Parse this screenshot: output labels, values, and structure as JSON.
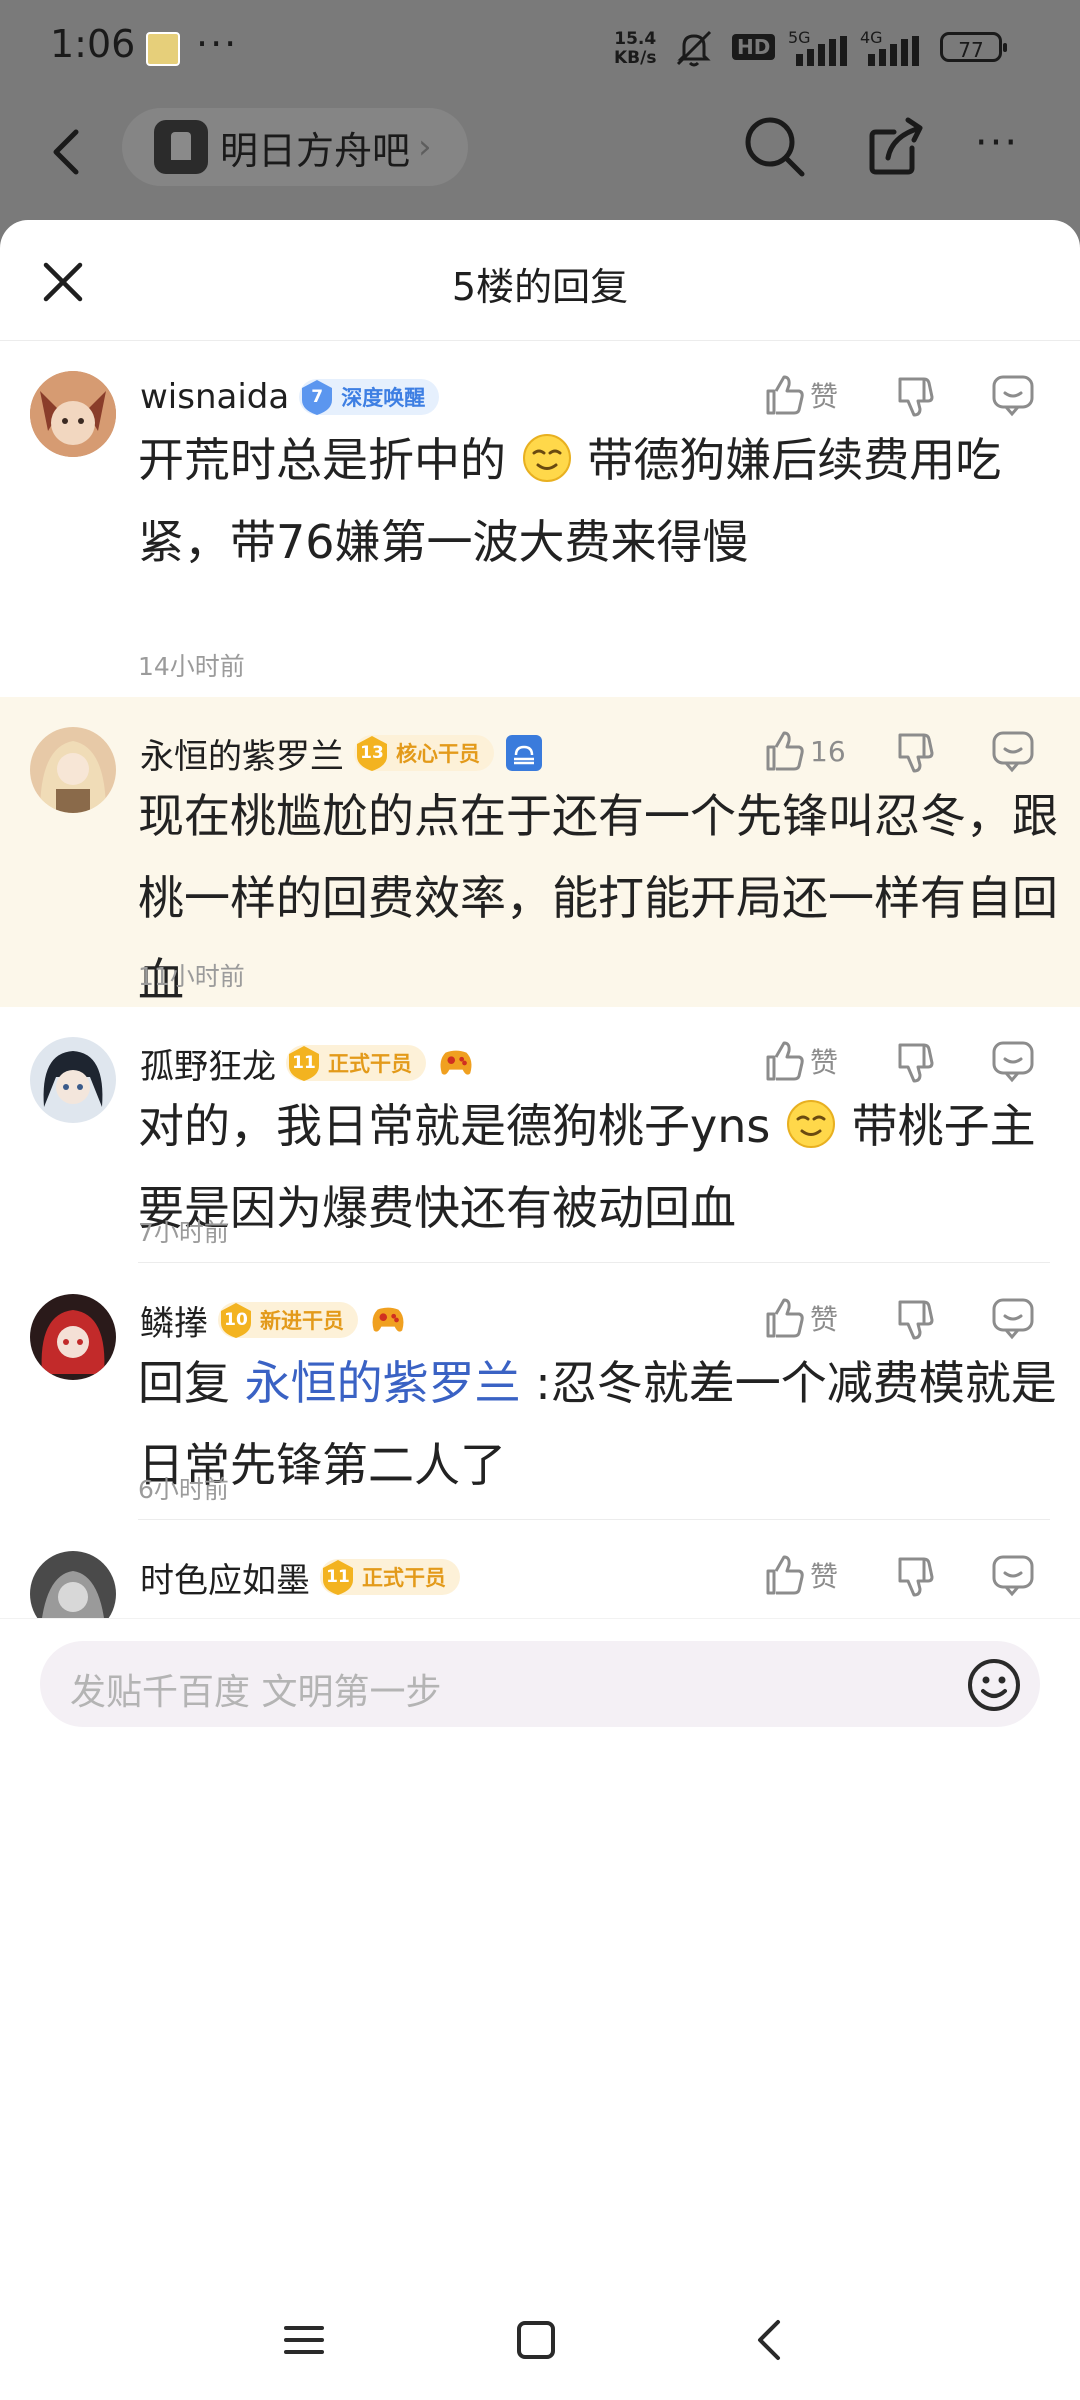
{
  "status_bar": {
    "time": "1:06",
    "more": "···",
    "speed_value": "15.4",
    "speed_unit": "KB/s",
    "hd": "HD",
    "net1": "5G",
    "net2": "4G",
    "battery": "77"
  },
  "top_nav": {
    "forum_name": "明日方舟吧",
    "forum_chevron": "›",
    "more": "···"
  },
  "sheet": {
    "title": "5楼的回复"
  },
  "replies": [
    {
      "username": "wisnaida",
      "level": "7",
      "level_title": "深度唤醒",
      "like_label": "赞",
      "text_1": "开荒时总是折中的",
      "text_2": "带德狗嫌后续费用吃紧，带76嫌第一波大费来得慢",
      "time": "14小时前"
    },
    {
      "username": "永恒的紫罗兰",
      "level": "13",
      "level_title": "核心干员",
      "like_label": "16",
      "text": "现在桃尴尬的点在于还有一个先锋叫忍冬，跟桃一样的回费效率，能打能开局还一样有自回血",
      "time": "11小时前"
    },
    {
      "username": "孤野狂龙",
      "level": "11",
      "level_title": "正式干员",
      "like_label": "赞",
      "text_1": "对的，我日常就是德狗桃子yns",
      "text_2": "带桃子主要是因为爆费快还有被动回血",
      "time": "7小时前"
    },
    {
      "username": "鳞搼",
      "level": "10",
      "level_title": "新进干员",
      "like_label": "赞",
      "reply_prefix": "回复 ",
      "mention": "永恒的紫罗兰",
      "text": " :忍冬就差一个减费模就是日常先锋第二人了",
      "time": "6小时前"
    },
    {
      "username": "时色应如墨",
      "level": "11",
      "level_title": "正式干员",
      "like_label": "赞"
    }
  ],
  "input": {
    "placeholder": "发贴千百度 文明第一步"
  },
  "colors": {
    "accent_blue": "#3e7fe3",
    "gold": "#f3b320",
    "highlight_bg": "#fcf7ea",
    "mention": "#3a62c4"
  }
}
